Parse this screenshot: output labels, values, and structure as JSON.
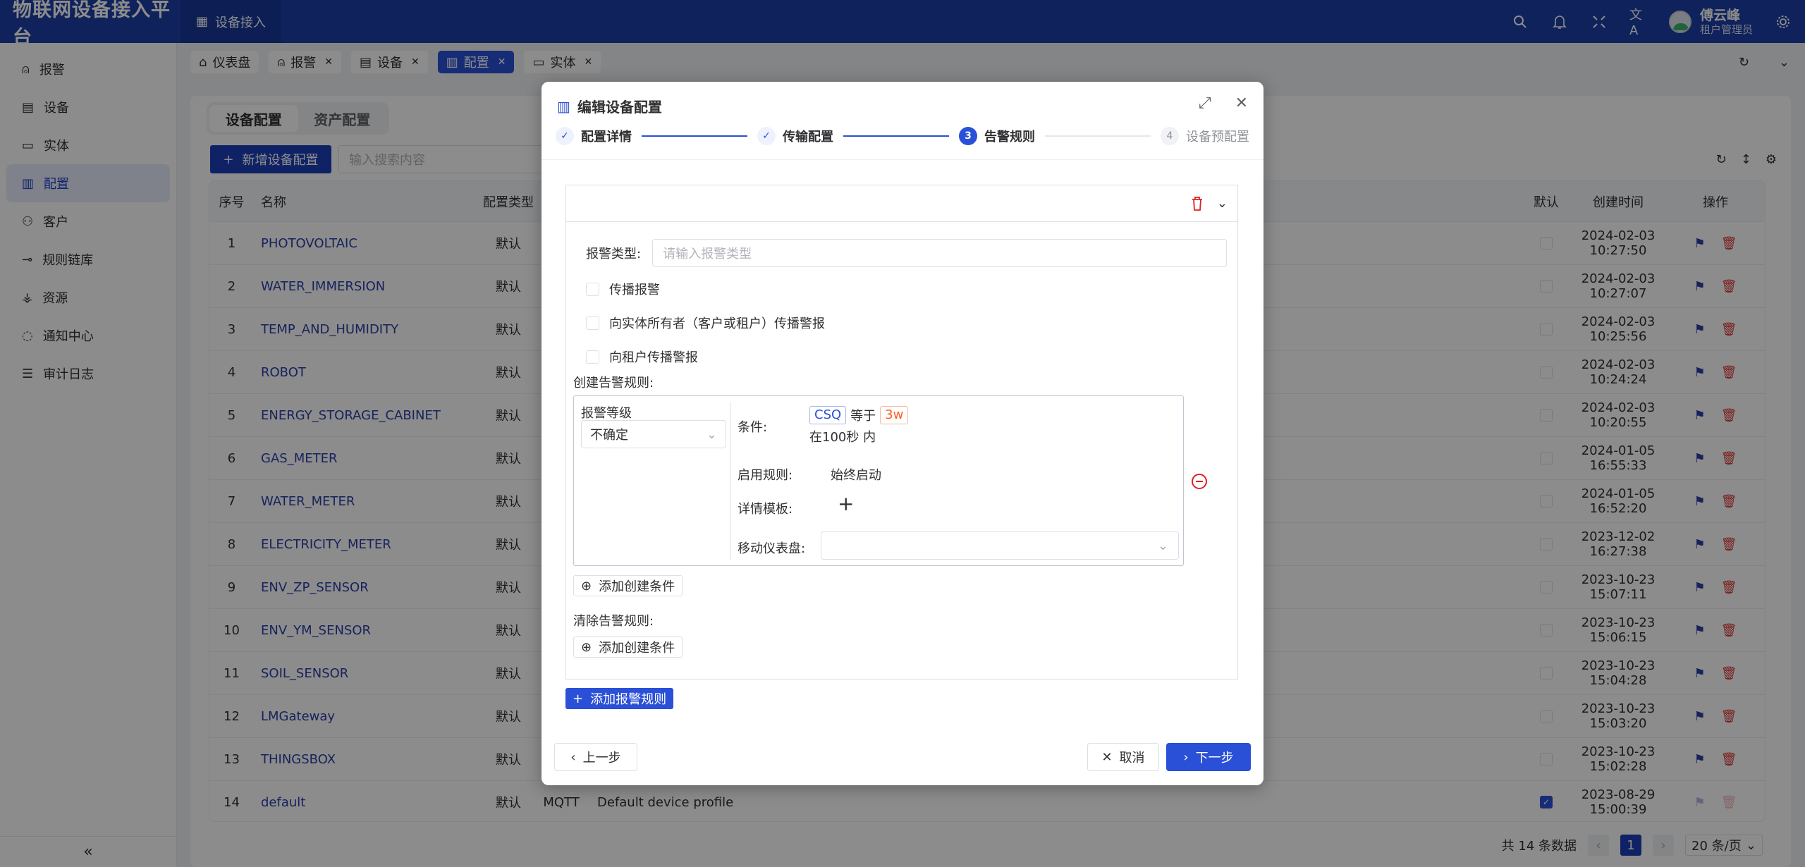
{
  "header": {
    "brand": "物联网设备接入平台",
    "nav": "设备接入",
    "user_name": "傅云峰",
    "user_role": "租户管理员"
  },
  "sidebar": {
    "items": [
      {
        "label": "报警",
        "icon": "alarm-icon"
      },
      {
        "label": "设备",
        "icon": "device-icon"
      },
      {
        "label": "实体",
        "icon": "monitor-icon"
      },
      {
        "label": "配置",
        "icon": "profile-icon",
        "active": true
      },
      {
        "label": "客户",
        "icon": "customer-icon"
      },
      {
        "label": "规则链库",
        "icon": "rule-chain-icon"
      },
      {
        "label": "资源",
        "icon": "resource-icon"
      },
      {
        "label": "通知中心",
        "icon": "chat-icon"
      },
      {
        "label": "审计日志",
        "icon": "list-icon"
      }
    ],
    "collapse": "«"
  },
  "tabs": [
    {
      "label": "仪表盘"
    },
    {
      "label": "报警"
    },
    {
      "label": "设备"
    },
    {
      "label": "配置",
      "active": true
    },
    {
      "label": "实体"
    }
  ],
  "page": {
    "seg": [
      "设备配置",
      "资产配置"
    ],
    "add_button": "新增设备配置",
    "search_placeholder": "输入搜索内容",
    "columns": {
      "idx": "序号",
      "name": "名称",
      "type": "配置类型",
      "default": "默认",
      "created": "创建时间",
      "ops": "操作"
    },
    "rows": [
      {
        "idx": "1",
        "name": "PHOTOVOLTAIC",
        "type": "默认",
        "proto": "",
        "desc": "",
        "default": false,
        "created": "2024-02-03 10:27:50"
      },
      {
        "idx": "2",
        "name": "WATER_IMMERSION",
        "type": "默认",
        "proto": "",
        "desc": "",
        "default": false,
        "created": "2024-02-03 10:27:07"
      },
      {
        "idx": "3",
        "name": "TEMP_AND_HUMIDITY",
        "type": "默认",
        "proto": "",
        "desc": "",
        "default": false,
        "created": "2024-02-03 10:25:56"
      },
      {
        "idx": "4",
        "name": "ROBOT",
        "type": "默认",
        "proto": "",
        "desc": "",
        "default": false,
        "created": "2024-02-03 10:24:24"
      },
      {
        "idx": "5",
        "name": "ENERGY_STORAGE_CABINET",
        "type": "默认",
        "proto": "",
        "desc": "",
        "default": false,
        "created": "2024-02-03 10:20:55"
      },
      {
        "idx": "6",
        "name": "GAS_METER",
        "type": "默认",
        "proto": "",
        "desc": "",
        "default": false,
        "created": "2024-01-05 16:55:33"
      },
      {
        "idx": "7",
        "name": "WATER_METER",
        "type": "默认",
        "proto": "",
        "desc": "",
        "default": false,
        "created": "2024-01-05 16:52:20"
      },
      {
        "idx": "8",
        "name": "ELECTRICITY_METER",
        "type": "默认",
        "proto": "",
        "desc": "",
        "default": false,
        "created": "2023-12-02 16:27:38"
      },
      {
        "idx": "9",
        "name": "ENV_ZP_SENSOR",
        "type": "默认",
        "proto": "",
        "desc": "",
        "default": false,
        "created": "2023-10-23 15:07:11"
      },
      {
        "idx": "10",
        "name": "ENV_YM_SENSOR",
        "type": "默认",
        "proto": "",
        "desc": "",
        "default": false,
        "created": "2023-10-23 15:06:15"
      },
      {
        "idx": "11",
        "name": "SOIL_SENSOR",
        "type": "默认",
        "proto": "",
        "desc": "",
        "default": false,
        "created": "2023-10-23 15:04:28"
      },
      {
        "idx": "12",
        "name": "LMGateway",
        "type": "默认",
        "proto": "",
        "desc": "",
        "default": false,
        "created": "2023-10-23 15:03:20"
      },
      {
        "idx": "13",
        "name": "THINGSBOX",
        "type": "默认",
        "proto": "",
        "desc": "",
        "default": false,
        "created": "2023-10-23 15:02:28"
      },
      {
        "idx": "14",
        "name": "default",
        "type": "默认",
        "proto": "MQTT",
        "desc": "Default device profile",
        "default": true,
        "created": "2023-08-29 15:00:39"
      }
    ],
    "pager": {
      "total": "共 14 条数据",
      "page": "1",
      "size": "20 条/页"
    }
  },
  "modal": {
    "title": "编辑设备配置",
    "steps": [
      {
        "label": "配置详情",
        "state": "done",
        "num": "✓"
      },
      {
        "label": "传输配置",
        "state": "done",
        "num": "✓"
      },
      {
        "label": "告警规则",
        "state": "current",
        "num": "3"
      },
      {
        "label": "设备预配置",
        "state": "todo",
        "num": "4"
      }
    ],
    "alarm_type_label": "报警类型:",
    "alarm_type_placeholder": "请输入报警类型",
    "checkboxes": [
      "传播报警",
      "向实体所有者（客户或租户）传播警报",
      "向租户传播警报"
    ],
    "create_rules_label": "创建告警规则:",
    "severity_label": "报警等级",
    "severity_value": "不确定",
    "condition_label": "条件:",
    "condition_key": "CSQ",
    "condition_op": "等于",
    "condition_value": "3w",
    "condition_duration": "在100秒 内",
    "enable_label": "启用规则:",
    "enable_value": "始终启动",
    "details_label": "详情模板:",
    "dashboard_label": "移动仪表盘:",
    "add_create_condition": "添加创建条件",
    "clear_rules_label": "清除告警规则:",
    "add_clear_condition": "添加创建条件",
    "add_alarm_rule": "添加报警规则",
    "prev": "上一步",
    "cancel": "取消",
    "next": "下一步"
  }
}
